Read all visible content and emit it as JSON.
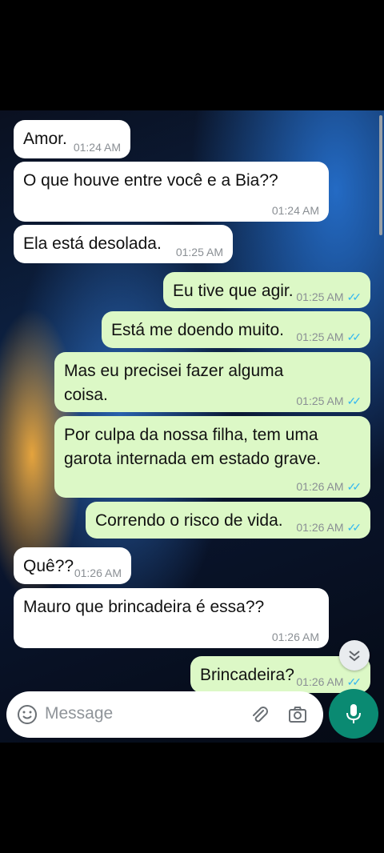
{
  "messages": [
    {
      "direction": "in",
      "text": "Amor.",
      "time": "01:24 AM"
    },
    {
      "direction": "in",
      "text": "O que houve entre você e a Bia??",
      "time": "01:24 AM"
    },
    {
      "direction": "in",
      "text": "Ela está desolada.",
      "time": "01:25 AM"
    },
    {
      "direction": "out",
      "text": "Eu tive que agir.",
      "time": "01:25 AM"
    },
    {
      "direction": "out",
      "text": "Está me doendo muito.",
      "time": "01:25 AM"
    },
    {
      "direction": "out",
      "text": "Mas eu precisei fazer alguma coisa.",
      "time": "01:25 AM"
    },
    {
      "direction": "out",
      "text": "Por culpa da nossa filha, tem uma garota internada em estado grave.",
      "time": "01:26 AM"
    },
    {
      "direction": "out",
      "text": "Correndo o risco de vida.",
      "time": "01:26 AM"
    },
    {
      "direction": "in",
      "text": "Quê??",
      "time": "01:26 AM"
    },
    {
      "direction": "in",
      "text": "Mauro que brincadeira é essa??",
      "time": "01:26 AM"
    },
    {
      "direction": "out",
      "text": "Brincadeira?",
      "time": "01:26 AM"
    }
  ],
  "composer": {
    "placeholder": "Message"
  },
  "icons": {
    "emoji": "emoji-icon",
    "attach": "paperclip-icon",
    "camera": "camera-icon",
    "mic": "microphone-icon",
    "scroll": "chevron-double-down-icon"
  },
  "colors": {
    "incoming": "#ffffff",
    "outgoing": "#dcf8c6",
    "read_tick": "#34b7f1",
    "mic_button": "#0a8a72"
  }
}
